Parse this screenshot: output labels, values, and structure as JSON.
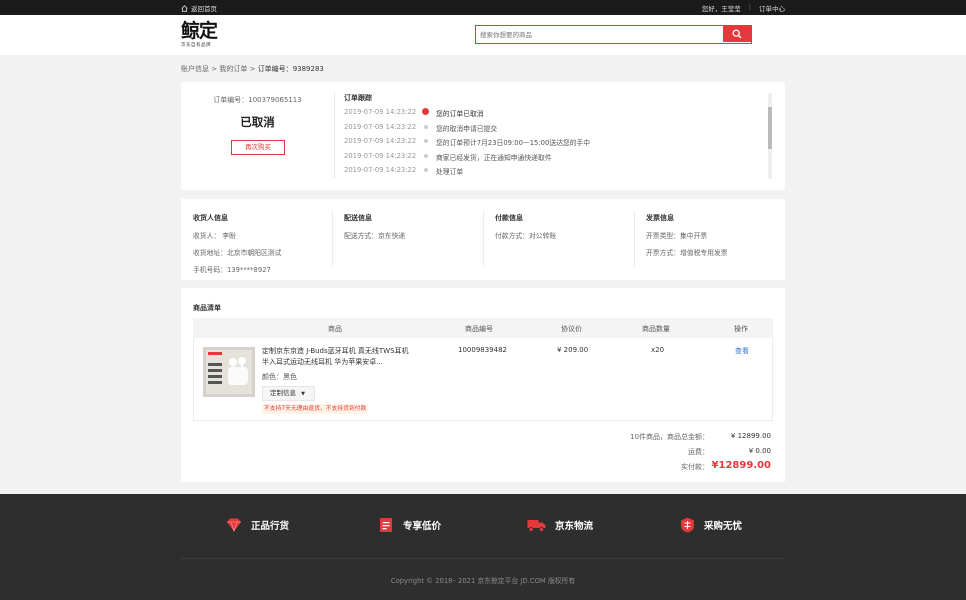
{
  "topbar": {
    "home_label": "返回首页",
    "greeting": "您好，王莹莹",
    "order_center": "订单中心"
  },
  "header": {
    "logo_text": "鲸定",
    "logo_sub": "京东自有品牌",
    "search_placeholder": "搜索你想要的商品"
  },
  "breadcrumb": {
    "account": "账户信息",
    "sep1": ">",
    "my_orders": "我的订单",
    "sep2": ">",
    "order_label": "订单编号：",
    "order_no": "9389283"
  },
  "order_status": {
    "order_no_text": "订单编号：100379065113",
    "status": "已取消",
    "rebuy_label": "再次购买"
  },
  "tracking": {
    "title": "订单跟踪",
    "events": [
      {
        "time": "2019-07-09 14:23:22",
        "text": "您的订单已取消"
      },
      {
        "time": "2019-07-09 14:23:22",
        "text": "您的取消申请已提交"
      },
      {
        "time": "2019-07-09 14:23:22",
        "text": "您的订单预计7月23日09:00—15:00送达您的手中"
      },
      {
        "time": "2019-07-09 14:23:22",
        "text": "商家已经发货，正在通知申通快递取件"
      },
      {
        "time": "2019-07-09 14:23:22",
        "text": "处理订单"
      }
    ]
  },
  "info": {
    "receiver": {
      "title": "收货人信息",
      "name": "收货人：  李盼",
      "address": "收货地址：北京市朝阳区测试",
      "phone": "手机号码：139****8927"
    },
    "delivery": {
      "title": "配送信息",
      "method": "配送方式：京东快递"
    },
    "payment": {
      "title": "付款信息",
      "method": "付款方式：对公转账"
    },
    "invoice": {
      "title": "发票信息",
      "type": "开票类型：集中开票",
      "method": "开票方式：增值税专用发票"
    }
  },
  "goods": {
    "title": "商品清单",
    "headers": [
      "商品",
      "商品编号",
      "协议价",
      "商品数量",
      "操作"
    ],
    "item": {
      "name": "定制京东京造 J-Buds蓝牙耳机 真无线TWS耳机 半入耳式运动无线耳机 华为苹果安卓...",
      "color": "颜色：黑色",
      "custom_label": "定制信息",
      "warning": "不支持7天无理由退货，不支持货到付款",
      "sku": "10009839482",
      "price": "¥ 209.00",
      "qty": "x20",
      "action": "查看"
    },
    "totals": {
      "goods_total_label": "10件商品，商品总金额：",
      "goods_total": "¥ 12899.00",
      "freight_label": "运费：",
      "freight": "¥ 0.00",
      "paid_label": "实付款：",
      "paid": "¥12899.00"
    }
  },
  "footer": {
    "features": [
      "正品行货",
      "专享低价",
      "京东物流",
      "采购无忧"
    ],
    "copyright": "Copyright © 2018– 2021 京东鲸定平台 JD.COM 版权所有"
  },
  "colors": {
    "accent": "#e4393c",
    "footer_bg": "#2e2e2e",
    "link": "#3a6fd8"
  }
}
